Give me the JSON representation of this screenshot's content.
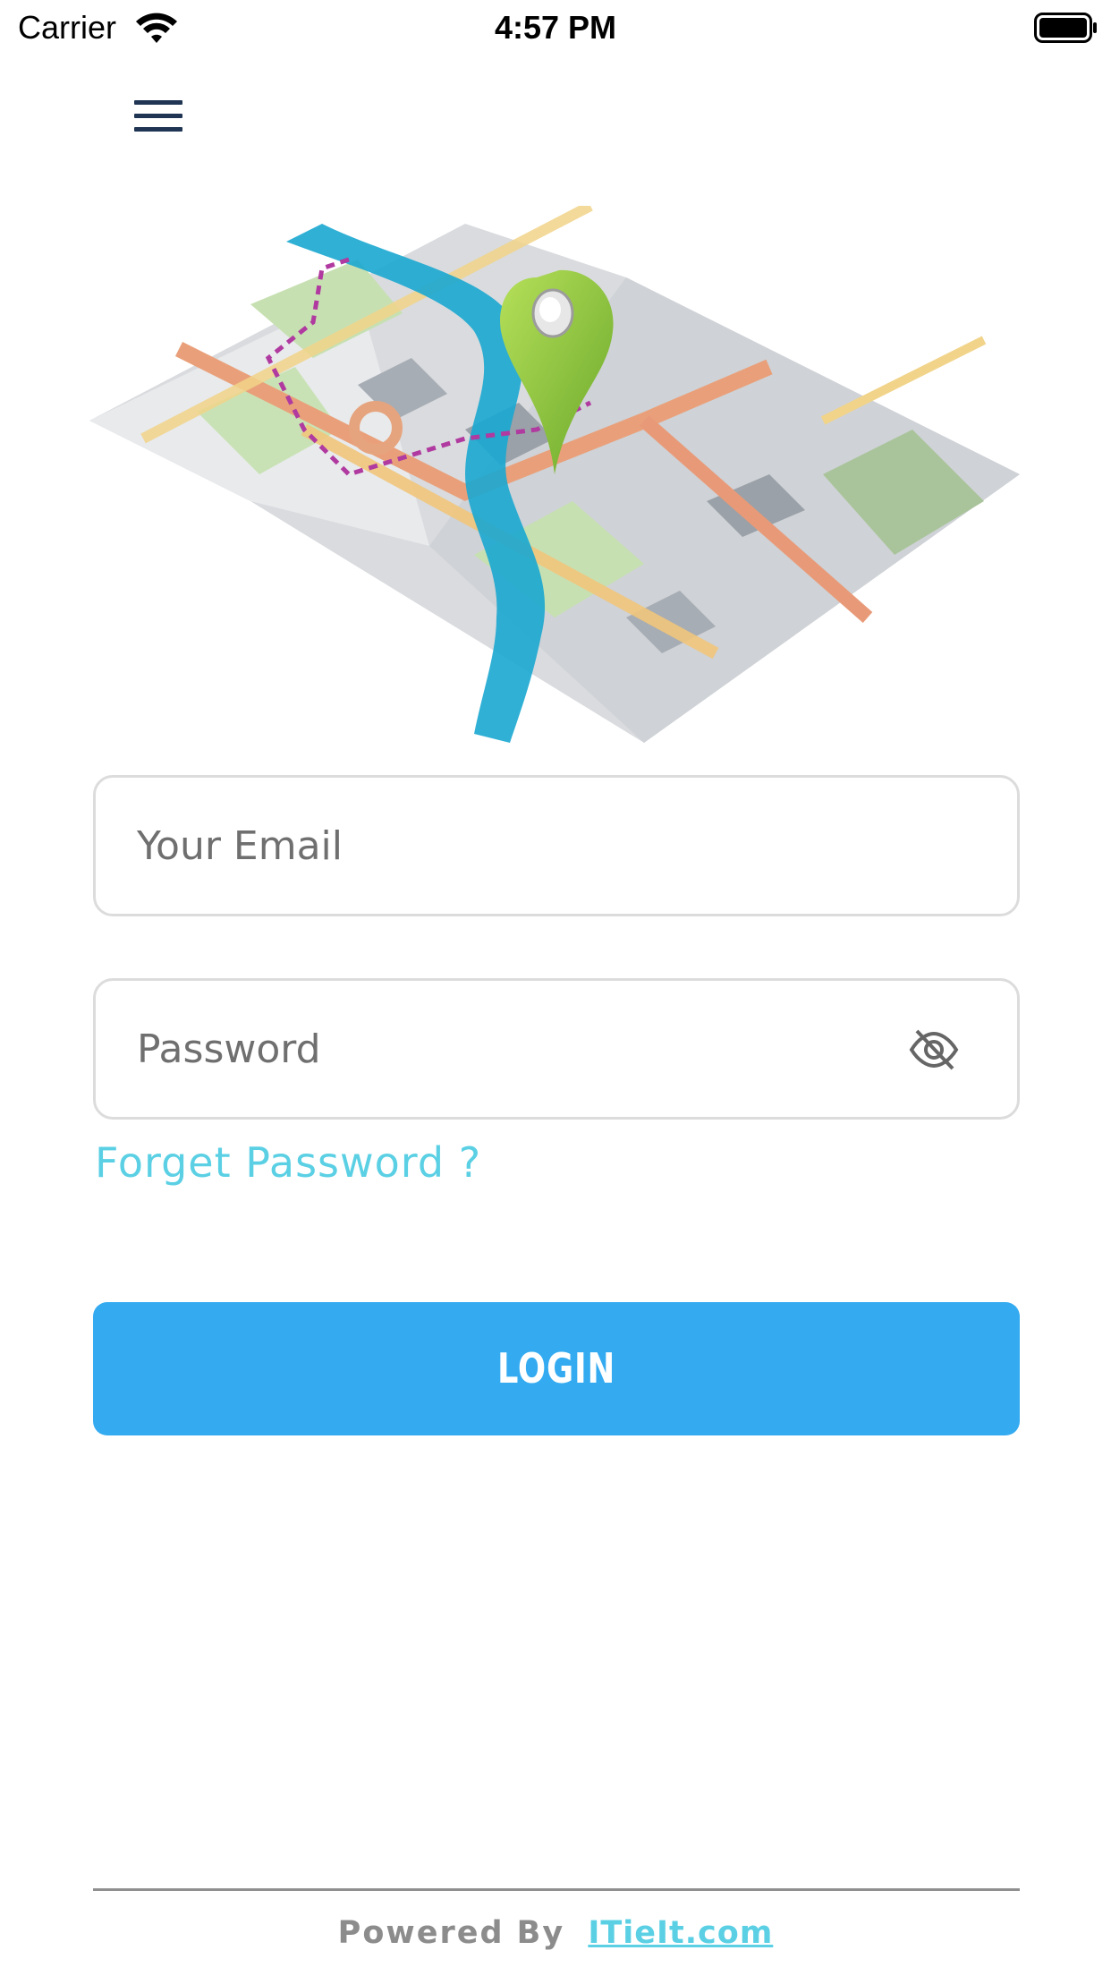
{
  "status_bar": {
    "carrier": "Carrier",
    "time": "4:57 PM",
    "icons": [
      "wifi-icon",
      "battery-icon"
    ]
  },
  "header": {
    "menu_icon": "hamburger-menu-icon"
  },
  "illustration": {
    "name": "map-with-location-pin",
    "colors": {
      "pin": "#8cc63f",
      "river": "#1aa7d0",
      "route": "#b03aa0"
    }
  },
  "form": {
    "email": {
      "placeholder": "Your Email",
      "value": ""
    },
    "password": {
      "placeholder": "Password",
      "value": "",
      "toggle_icon": "eye-slash-icon"
    },
    "forget_password": "Forget Password ?",
    "login_label": "LOGIN"
  },
  "footer": {
    "powered_by": "Powered By",
    "link_text": "ITieIt.com"
  },
  "colors": {
    "accent": "#34abf1",
    "link": "#5bd0e4",
    "menu": "#1f3553"
  }
}
